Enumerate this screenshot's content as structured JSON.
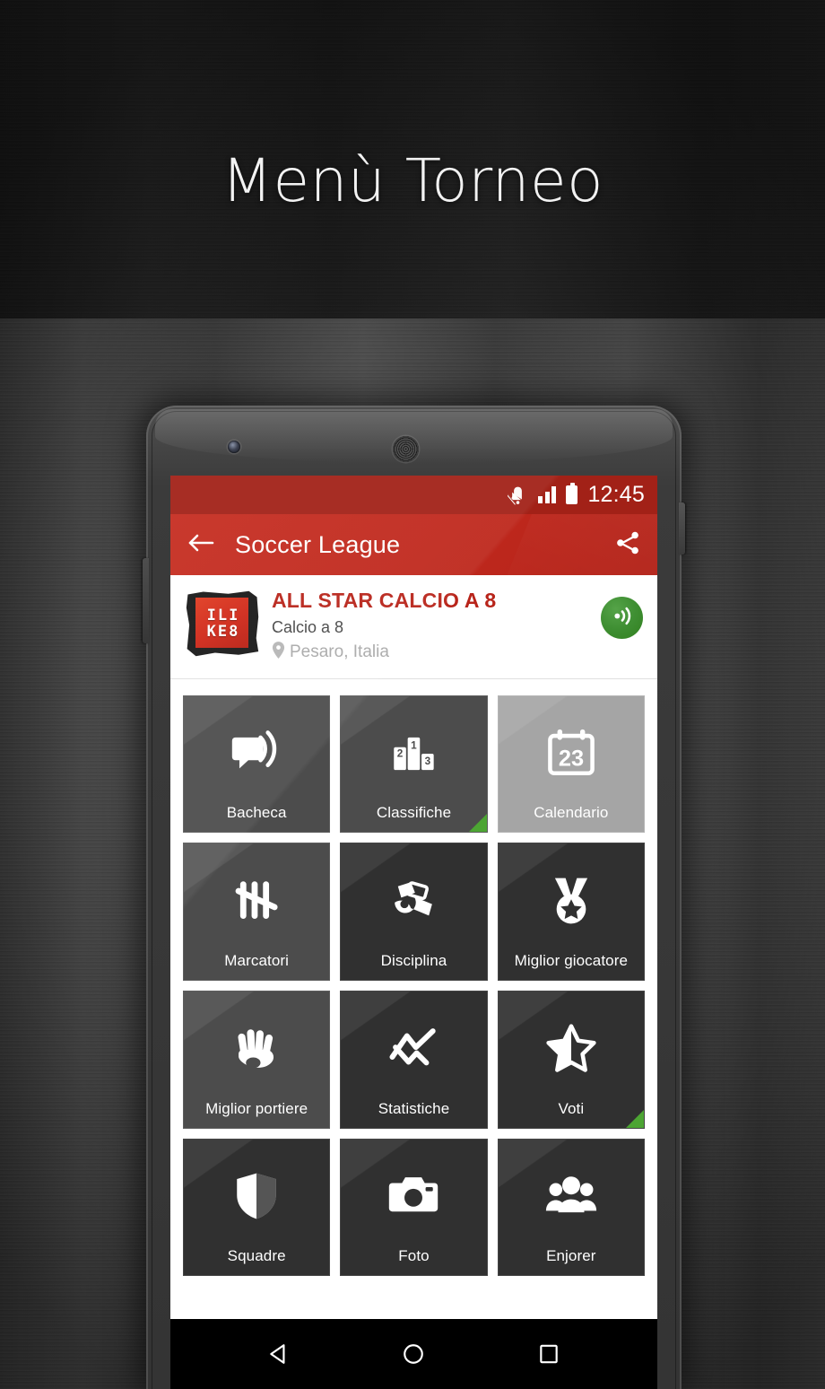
{
  "poster": {
    "title": "Menù Torneo"
  },
  "status_bar": {
    "time": "12:45",
    "icons": [
      "mute-icon",
      "signal-bars-icon",
      "battery-icon"
    ]
  },
  "app_bar": {
    "back_icon": "back-arrow-icon",
    "title": "Soccer League",
    "share_icon": "share-icon"
  },
  "tournament": {
    "logo_line1": "ILI",
    "logo_line2": "KE8",
    "name": "ALL STAR CALCIO A 8",
    "sport": "Calcio a 8",
    "location": "Pesaro, Italia",
    "location_icon": "map-pin-icon",
    "live_icon": "broadcast-icon"
  },
  "menu": {
    "tiles": [
      {
        "label": "Bacheca",
        "icon": "broadcast-message-icon",
        "shade": "light",
        "flag": false
      },
      {
        "label": "Classifiche",
        "icon": "podium-icon",
        "shade": "light",
        "flag": true
      },
      {
        "label": "Calendario",
        "icon": "calendar-23-icon",
        "shade": "pressed",
        "flag": false
      },
      {
        "label": "Marcatori",
        "icon": "tally-marks-icon",
        "shade": "light",
        "flag": false
      },
      {
        "label": "Disciplina",
        "icon": "whistle-card-icon",
        "shade": "dark",
        "flag": false
      },
      {
        "label": "Miglior giocatore",
        "icon": "medal-star-icon",
        "shade": "dark",
        "flag": false
      },
      {
        "label": "Miglior portiere",
        "icon": "goalkeeper-glove-icon",
        "shade": "light",
        "flag": false
      },
      {
        "label": "Statistiche",
        "icon": "line-chart-icon",
        "shade": "dark",
        "flag": false
      },
      {
        "label": "Voti",
        "icon": "half-star-icon",
        "shade": "dark",
        "flag": true
      },
      {
        "label": "Squadre",
        "icon": "shield-icon",
        "shade": "dark",
        "flag": false
      },
      {
        "label": "Foto",
        "icon": "camera-icon",
        "shade": "dark",
        "flag": false
      },
      {
        "label": "Enjorer",
        "icon": "people-group-icon",
        "shade": "dark",
        "flag": false
      }
    ]
  },
  "nav_bar": {
    "back": "nav-back-triangle-icon",
    "home": "nav-home-circle-icon",
    "recents": "nav-recents-square-icon"
  },
  "colors": {
    "status_bar": "#a22117",
    "app_bar": "#c0281d",
    "tournament_name": "#b8241a",
    "live_button": "#3f8f33",
    "flag_green": "#4ca533",
    "tile_light": "#4c4c4c",
    "tile_dark": "#303030",
    "tile_pressed": "#a5a5a5"
  }
}
